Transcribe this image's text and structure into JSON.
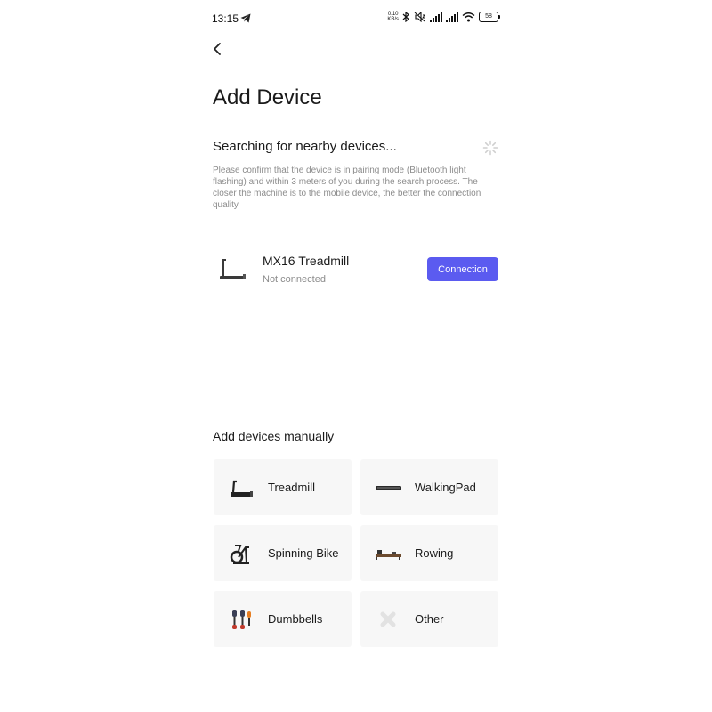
{
  "status_bar": {
    "time": "13:15",
    "net_speed_value": "0.10",
    "net_speed_unit": "KB/s",
    "battery": "58"
  },
  "header": {
    "back_icon": "chevron-left-icon",
    "title": "Add Device"
  },
  "search": {
    "title": "Searching for nearby devices...",
    "hint": "Please confirm that the device is in pairing mode (Bluetooth light flashing) and within 3 meters of you during the search process. The closer the machine is to the mobile device, the better the connection quality."
  },
  "found_device": {
    "name": "MX16 Treadmill",
    "status": "Not connected",
    "button_label": "Connection",
    "accent": "#5b5bf0"
  },
  "manual": {
    "title": "Add devices manually",
    "items": [
      {
        "label": "Treadmill",
        "icon": "treadmill-icon"
      },
      {
        "label": "WalkingPad",
        "icon": "walkingpad-icon"
      },
      {
        "label": "Spinning Bike",
        "icon": "spinning-bike-icon"
      },
      {
        "label": "Rowing",
        "icon": "rowing-machine-icon"
      },
      {
        "label": "Dumbbells",
        "icon": "dumbbells-icon"
      },
      {
        "label": "Other",
        "icon": "other-icon"
      }
    ]
  }
}
